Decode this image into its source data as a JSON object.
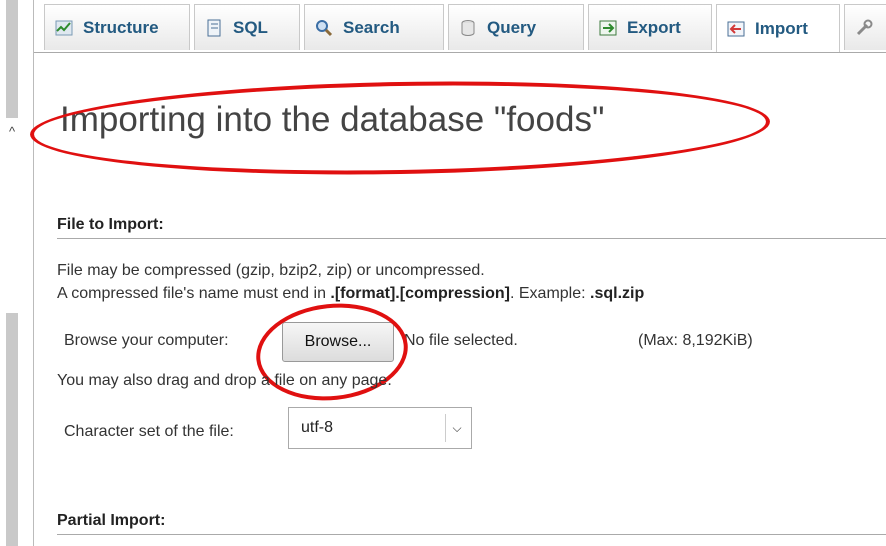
{
  "tabs": [
    {
      "label": "Structure",
      "icon": "structure-icon"
    },
    {
      "label": "SQL",
      "icon": "sql-icon"
    },
    {
      "label": "Search",
      "icon": "search-icon"
    },
    {
      "label": "Query",
      "icon": "query-icon"
    },
    {
      "label": "Export",
      "icon": "export-icon"
    },
    {
      "label": "Import",
      "icon": "import-icon",
      "active": true
    }
  ],
  "page_title": "Importing into the database \"foods\"",
  "file_to_import": {
    "heading": "File to Import:",
    "line1": "File may be compressed (gzip, bzip2, zip) or uncompressed.",
    "line2_prefix": "A compressed file's name must end in ",
    "line2_format": ".[format].[compression]",
    "line2_mid": ". Example: ",
    "line2_example": ".sql.zip",
    "browse_label": "Browse your computer:",
    "browse_button": "Browse...",
    "no_file": "No file selected.",
    "max_size": "(Max: 8,192KiB)",
    "drag_hint": "You may also drag and drop a file on any page.",
    "charset_label": "Character set of the file:",
    "charset_value": "utf-8"
  },
  "partial_import": {
    "heading": "Partial Import:"
  },
  "colors": {
    "tab_text": "#235a81",
    "annotation_red": "#e01010"
  }
}
